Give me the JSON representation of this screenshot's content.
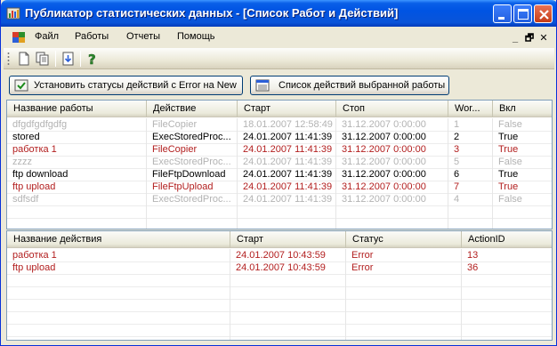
{
  "window": {
    "title": "Публикатор статистических данных - [Список Работ и Действий]"
  },
  "menu": {
    "items": [
      "Файл",
      "Работы",
      "Отчеты",
      "Помощь"
    ],
    "mdi_controls": [
      "_",
      "🗗",
      "✕"
    ]
  },
  "toolbar": {
    "icons": [
      "new-document-icon",
      "copy-document-icon",
      "import-icon",
      "help-icon"
    ]
  },
  "buttons": {
    "set_statuses": "Установить статусы действий с Error на New",
    "action_list": "Список действий выбранной работы"
  },
  "jobs_table": {
    "columns": [
      "Название работы",
      "Действие",
      "Старт",
      "Стоп",
      "Wor...",
      "Вкл"
    ],
    "rows": [
      {
        "name": "dfgdfgdfgdfg",
        "action": "FileCopier",
        "start": "18.01.2007 12:58:49",
        "stop": "31.12.2007 0:00:00",
        "wor": "1",
        "enabled": "False",
        "state": "disabled"
      },
      {
        "name": "stored",
        "action": "ExecStoredProc...",
        "start": "24.01.2007 11:41:39",
        "stop": "31.12.2007 0:00:00",
        "wor": "2",
        "enabled": "True",
        "state": "normal"
      },
      {
        "name": "работка 1",
        "action": "FileCopier",
        "start": "24.01.2007 11:41:39",
        "stop": "31.12.2007 0:00:00",
        "wor": "3",
        "enabled": "True",
        "state": "error"
      },
      {
        "name": "zzzz",
        "action": "ExecStoredProc...",
        "start": "24.01.2007 11:41:39",
        "stop": "31.12.2007 0:00:00",
        "wor": "5",
        "enabled": "False",
        "state": "disabled"
      },
      {
        "name": "ftp download",
        "action": "FileFtpDownload",
        "start": "24.01.2007 11:41:39",
        "stop": "31.12.2007 0:00:00",
        "wor": "6",
        "enabled": "True",
        "state": "normal"
      },
      {
        "name": "ftp upload",
        "action": "FileFtpUpload",
        "start": "24.01.2007 11:41:39",
        "stop": "31.12.2007 0:00:00",
        "wor": "7",
        "enabled": "True",
        "state": "error"
      },
      {
        "name": "sdfsdf",
        "action": "ExecStoredProc...",
        "start": "24.01.2007 11:41:39",
        "stop": "31.12.2007 0:00:00",
        "wor": "4",
        "enabled": "False",
        "state": "disabled"
      }
    ]
  },
  "actions_table": {
    "columns": [
      "Название действия",
      "Старт",
      "Статус",
      "ActionID"
    ],
    "rows": [
      {
        "name": "работка 1",
        "start": "24.01.2007 10:43:59",
        "status": "Error",
        "id": "13",
        "state": "error"
      },
      {
        "name": "ftp upload",
        "start": "24.01.2007 10:43:59",
        "status": "Error",
        "id": "36",
        "state": "error"
      }
    ]
  },
  "colors": {
    "titlebar": "#0054e3",
    "error_text": "#b21e1e",
    "disabled_text": "#b3b3b3",
    "grid_border": "#7f9db9"
  }
}
